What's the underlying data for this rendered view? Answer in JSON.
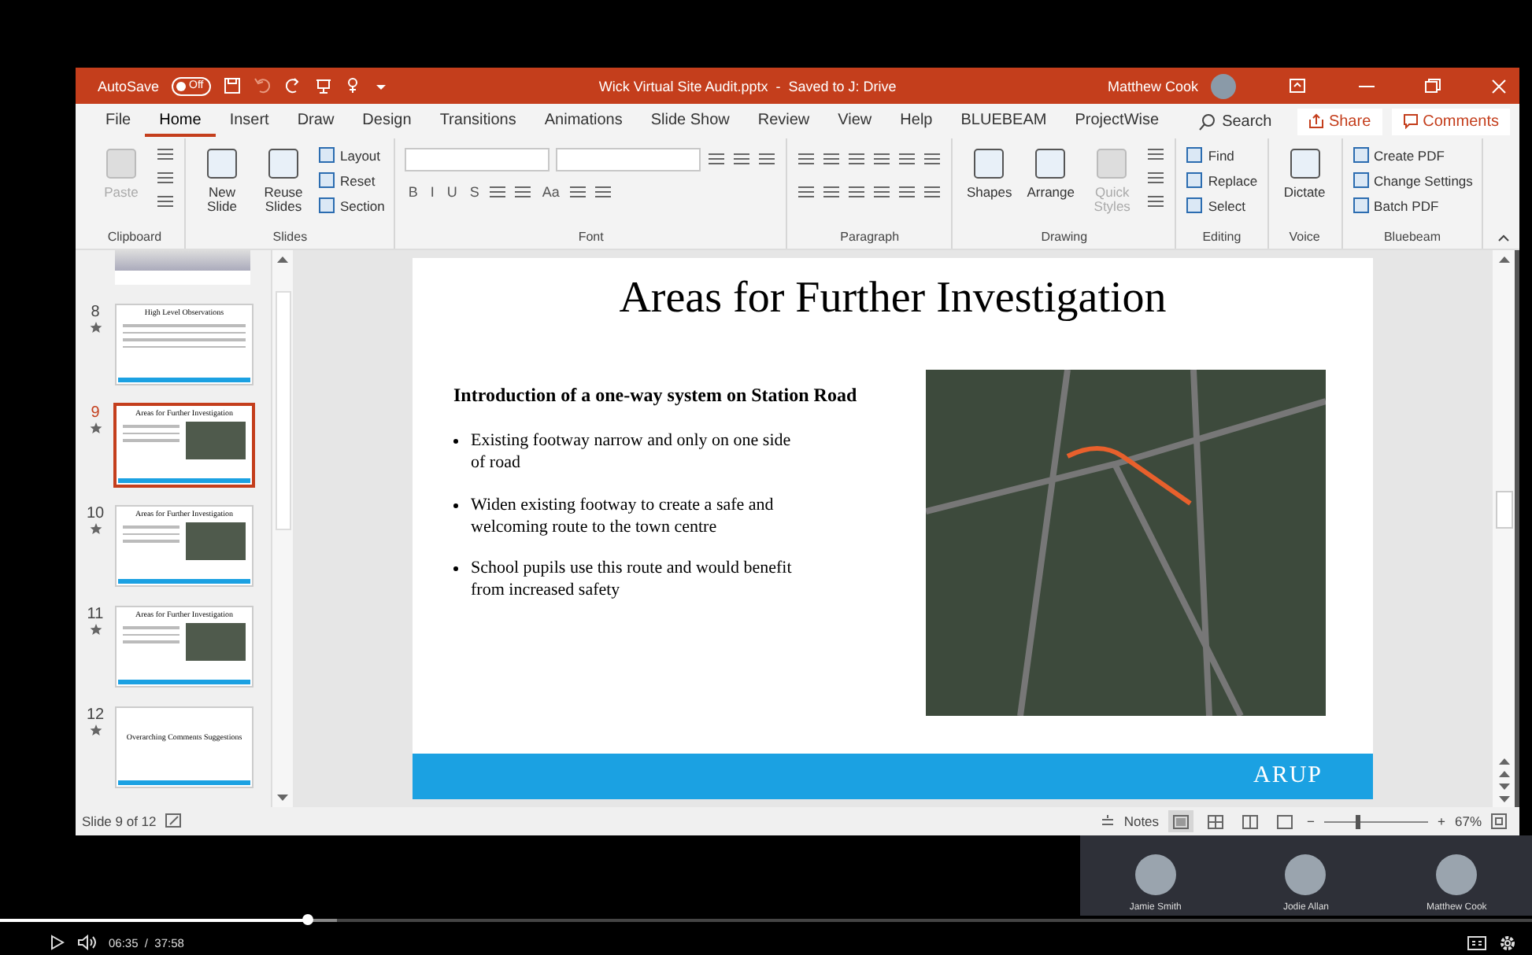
{
  "title_bar": {
    "autosave_label": "AutoSave",
    "autosave_toggle": {
      "label": "Off",
      "on": false
    },
    "document_title": "Wick Virtual Site Audit.pptx  -  Saved to J: Drive",
    "user_name": "Matthew Cook"
  },
  "menu_tabs": [
    {
      "label": "File",
      "selected": false
    },
    {
      "label": "Home",
      "selected": true
    },
    {
      "label": "Insert",
      "selected": false
    },
    {
      "label": "Draw",
      "selected": false
    },
    {
      "label": "Design",
      "selected": false
    },
    {
      "label": "Transitions",
      "selected": false
    },
    {
      "label": "Animations",
      "selected": false
    },
    {
      "label": "Slide Show",
      "selected": false
    },
    {
      "label": "Review",
      "selected": false
    },
    {
      "label": "View",
      "selected": false
    },
    {
      "label": "Help",
      "selected": false
    },
    {
      "label": "BLUEBEAM",
      "selected": false
    },
    {
      "label": "ProjectWise",
      "selected": false
    }
  ],
  "search": {
    "label": "Search"
  },
  "share_button": "Share",
  "comments_button": "Comments",
  "ribbon": {
    "groups": [
      {
        "label": "Clipboard",
        "items": [
          {
            "kind": "large",
            "label": "Paste",
            "disabled": true
          },
          {
            "kind": "column",
            "entries": [
              {
                "kind": "icon"
              },
              {
                "kind": "icon"
              },
              {
                "kind": "icon"
              }
            ]
          }
        ]
      },
      {
        "label": "Slides",
        "items": [
          {
            "kind": "large",
            "label": "New Slide",
            "disabled": false
          },
          {
            "kind": "large",
            "label": "Reuse Slides",
            "disabled": false
          },
          {
            "kind": "column",
            "entries": [
              {
                "kind": "small",
                "label": "Layout",
                "disabled": false
              },
              {
                "kind": "small",
                "label": "Reset",
                "disabled": false
              },
              {
                "kind": "small",
                "label": "Section",
                "disabled": false
              }
            ]
          }
        ]
      },
      {
        "label": "Font",
        "items": [
          {
            "kind": "column",
            "entries": [
              {
                "kind": "line",
                "entries": [
                  {
                    "kind": "field"
                  },
                  {
                    "kind": "field"
                  },
                  {
                    "kind": "icon"
                  },
                  {
                    "kind": "icon"
                  },
                  {
                    "kind": "icon"
                  }
                ]
              },
              {
                "kind": "line",
                "entries": [
                  {
                    "kind": "text",
                    "label": "B"
                  },
                  {
                    "kind": "text",
                    "label": "I"
                  },
                  {
                    "kind": "text",
                    "label": "U"
                  },
                  {
                    "kind": "text",
                    "label": "S"
                  },
                  {
                    "kind": "icon"
                  },
                  {
                    "kind": "icon"
                  },
                  {
                    "kind": "text",
                    "label": "Aa"
                  },
                  {
                    "kind": "icon"
                  },
                  {
                    "kind": "icon"
                  }
                ]
              }
            ]
          }
        ]
      },
      {
        "label": "Paragraph",
        "items": [
          {
            "kind": "column",
            "entries": [
              {
                "kind": "line",
                "entries": [
                  {
                    "kind": "icon"
                  },
                  {
                    "kind": "icon"
                  },
                  {
                    "kind": "icon"
                  },
                  {
                    "kind": "icon"
                  },
                  {
                    "kind": "icon"
                  },
                  {
                    "kind": "icon"
                  }
                ]
              },
              {
                "kind": "line",
                "entries": [
                  {
                    "kind": "icon"
                  },
                  {
                    "kind": "icon"
                  },
                  {
                    "kind": "icon"
                  },
                  {
                    "kind": "icon"
                  },
                  {
                    "kind": "icon"
                  },
                  {
                    "kind": "icon"
                  }
                ]
              }
            ]
          }
        ]
      },
      {
        "label": "Drawing",
        "items": [
          {
            "kind": "large",
            "label": "Shapes",
            "disabled": false
          },
          {
            "kind": "large",
            "label": "Arrange",
            "disabled": false
          },
          {
            "kind": "large",
            "label": "Quick Styles",
            "disabled": true
          },
          {
            "kind": "column",
            "entries": [
              {
                "kind": "icon"
              },
              {
                "kind": "icon"
              },
              {
                "kind": "icon"
              }
            ]
          }
        ]
      },
      {
        "label": "Editing",
        "items": [
          {
            "kind": "column",
            "entries": [
              {
                "kind": "small",
                "label": "Find",
                "disabled": false
              },
              {
                "kind": "small",
                "label": "Replace",
                "disabled": false
              },
              {
                "kind": "small",
                "label": "Select",
                "disabled": false
              }
            ]
          }
        ]
      },
      {
        "label": "Voice",
        "items": [
          {
            "kind": "large",
            "label": "Dictate",
            "disabled": false
          }
        ]
      },
      {
        "label": "Bluebeam",
        "items": [
          {
            "kind": "column",
            "entries": [
              {
                "kind": "small",
                "label": "Create PDF",
                "disabled": false
              },
              {
                "kind": "small",
                "label": "Change Settings",
                "disabled": false
              },
              {
                "kind": "small",
                "label": "Batch PDF",
                "disabled": false
              }
            ]
          }
        ]
      }
    ]
  },
  "thumbnails": [
    {
      "kind": "partial",
      "selected": false
    },
    {
      "kind": "text",
      "number": "8",
      "title": "High Level Observations",
      "selected": false
    },
    {
      "kind": "picture",
      "number": "9",
      "title": "Areas for Further Investigation",
      "selected": true
    },
    {
      "kind": "picture",
      "number": "10",
      "title": "Areas for Further Investigation",
      "selected": false
    },
    {
      "kind": "picture",
      "number": "11",
      "title": "Areas for Further Investigation",
      "selected": false
    },
    {
      "kind": "title",
      "number": "12",
      "title": "Overarching Comments Suggestions",
      "selected": false
    }
  ],
  "slide": {
    "title": "Areas for Further Investigation",
    "subtitle": "Introduction of a one-way system on Station Road",
    "bullets": [
      "Existing footway narrow and only on one side of road",
      "Widen existing footway to create a safe and welcoming route to the town centre",
      "School pupils use this route and would benefit from increased safety"
    ],
    "logo": "ARUP"
  },
  "status_bar": {
    "slide_count": "Slide 9 of 12",
    "notes": "Notes",
    "views": [
      {
        "selected": true
      },
      {
        "selected": false
      },
      {
        "selected": false
      },
      {
        "selected": false
      }
    ],
    "zoom_out": "−",
    "zoom_slider": {
      "level": 0.3
    },
    "zoom_in": "+",
    "zoom": "67%"
  },
  "participants": [
    {
      "name": "Jamie Smith"
    },
    {
      "name": "Jodie Allan"
    },
    {
      "name": "Matthew Cook"
    }
  ],
  "player": {
    "progress": {
      "level": 0.2
    },
    "buffered": {
      "level": 0.22
    },
    "time": "06:35  /  37:58"
  }
}
